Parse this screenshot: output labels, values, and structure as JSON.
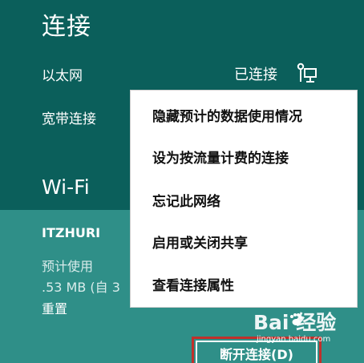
{
  "panel": {
    "title": "连接",
    "ethernet_label": "以太网",
    "ethernet_status": "已连接",
    "broadband_label": "宽带连接",
    "wifi_heading": "Wi-Fi",
    "network_name": "ITZHURI",
    "usage_label": "预计使用",
    "usage_value": ".53 MB (自 3",
    "reset_label": "重置",
    "disconnect_label": "断开连接(D)"
  },
  "context_menu": {
    "items": [
      "隐藏预计的数据使用情况",
      "设为按流量计费的连接",
      "忘记此网络",
      "启用或关闭共享",
      "查看连接属性"
    ]
  },
  "watermark": {
    "logo": "Bai 经验",
    "subtext": "jingyan.baidu.com"
  },
  "colors": {
    "panel_dark": "#0b5f5b",
    "panel_light": "#2f8f88",
    "menu_background": "#ffffff",
    "highlight_border": "#c0302b"
  },
  "icons": {
    "ethernet": "network-plug-icon",
    "watermark": "paw-icon"
  }
}
